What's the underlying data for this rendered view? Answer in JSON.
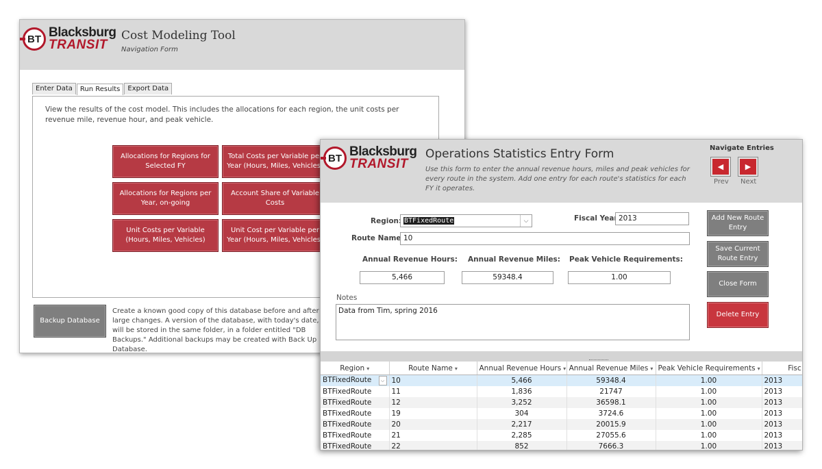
{
  "navform": {
    "logo": {
      "line1": "Blacksburg",
      "line2": "TRANSIT",
      "badge": "BT"
    },
    "title": "Cost Modeling Tool",
    "subtitle": "Navigation Form",
    "tabs": [
      "Enter Data",
      "Run Results",
      "Export Data"
    ],
    "active_tab": "Run Results",
    "description": "View the results of the cost model. This includes the allocations for each region, the unit costs per revenue mile, revenue hour, and peak vehicle.",
    "buttons": [
      "Allocations for Regions for Selected FY",
      "Total Costs per Variable per Year (Hours, Miles, Vehicles)",
      "Allocations for Regions per Year, on-going",
      "Account Share of Variable Costs",
      "Unit Costs per Variable (Hours, Miles, Vehicles)",
      "Unit Cost per Variable per Year (Hours, Miles, Vehicles)"
    ],
    "backup_button": "Backup Database",
    "backup_text": "Create a known good copy of this database before and after large changes. A version of the database, with today's date, will be stored in the same folder, in a folder entitled \"DB Backups.\" Additional backups may be created with Back Up Database."
  },
  "opsform": {
    "logo": {
      "line1": "Blacksburg",
      "line2": "TRANSIT",
      "badge": "BT"
    },
    "title": "Operations Statistics Entry Form",
    "subtitle": "Use this form to enter the annual revenue hours, miles and peak vehicles for every route in the system. Add one entry for each route's statistics for each FY it operates.",
    "nav": {
      "title": "Navigate Entries",
      "prev": "Prev",
      "next": "Next"
    },
    "labels": {
      "region": "Region:",
      "fiscal_year": "Fiscal Year:",
      "route_name": "Route Name:",
      "rev_hours": "Annual Revenue Hours:",
      "rev_miles": "Annual Revenue Miles:",
      "peak": "Peak Vehicle Requirements:",
      "notes": "Notes"
    },
    "values": {
      "region": "BTFixedRoute",
      "fiscal_year": "2013",
      "route_name": "10",
      "rev_hours": "5,466",
      "rev_miles": "59348.4",
      "peak": "1.00",
      "notes": "Data from Tim, spring 2016"
    },
    "buttons": {
      "add": "Add New Route Entry",
      "save": "Save Current Route Entry",
      "close": "Close Form",
      "delete": "Delete Entry"
    },
    "table": {
      "columns": [
        "Region",
        "Route Name",
        "Annual Revenue Hours",
        "Annual Revenue Miles",
        "Peak Vehicle Requirements",
        "Fisc"
      ],
      "rows": [
        [
          "BTFixedRoute",
          "10",
          "5,466",
          "59348.4",
          "1.00",
          "2013"
        ],
        [
          "BTFixedRoute",
          "11",
          "1,836",
          "21747",
          "1.00",
          "2013"
        ],
        [
          "BTFixedRoute",
          "12",
          "3,252",
          "36598.1",
          "1.00",
          "2013"
        ],
        [
          "BTFixedRoute",
          "19",
          "304",
          "3724.6",
          "1.00",
          "2013"
        ],
        [
          "BTFixedRoute",
          "20",
          "2,217",
          "20015.9",
          "1.00",
          "2013"
        ],
        [
          "BTFixedRoute",
          "21",
          "2,285",
          "27055.6",
          "1.00",
          "2013"
        ],
        [
          "BTFixedRoute",
          "22",
          "852",
          "7666.3",
          "1.00",
          "2013"
        ]
      ]
    }
  }
}
